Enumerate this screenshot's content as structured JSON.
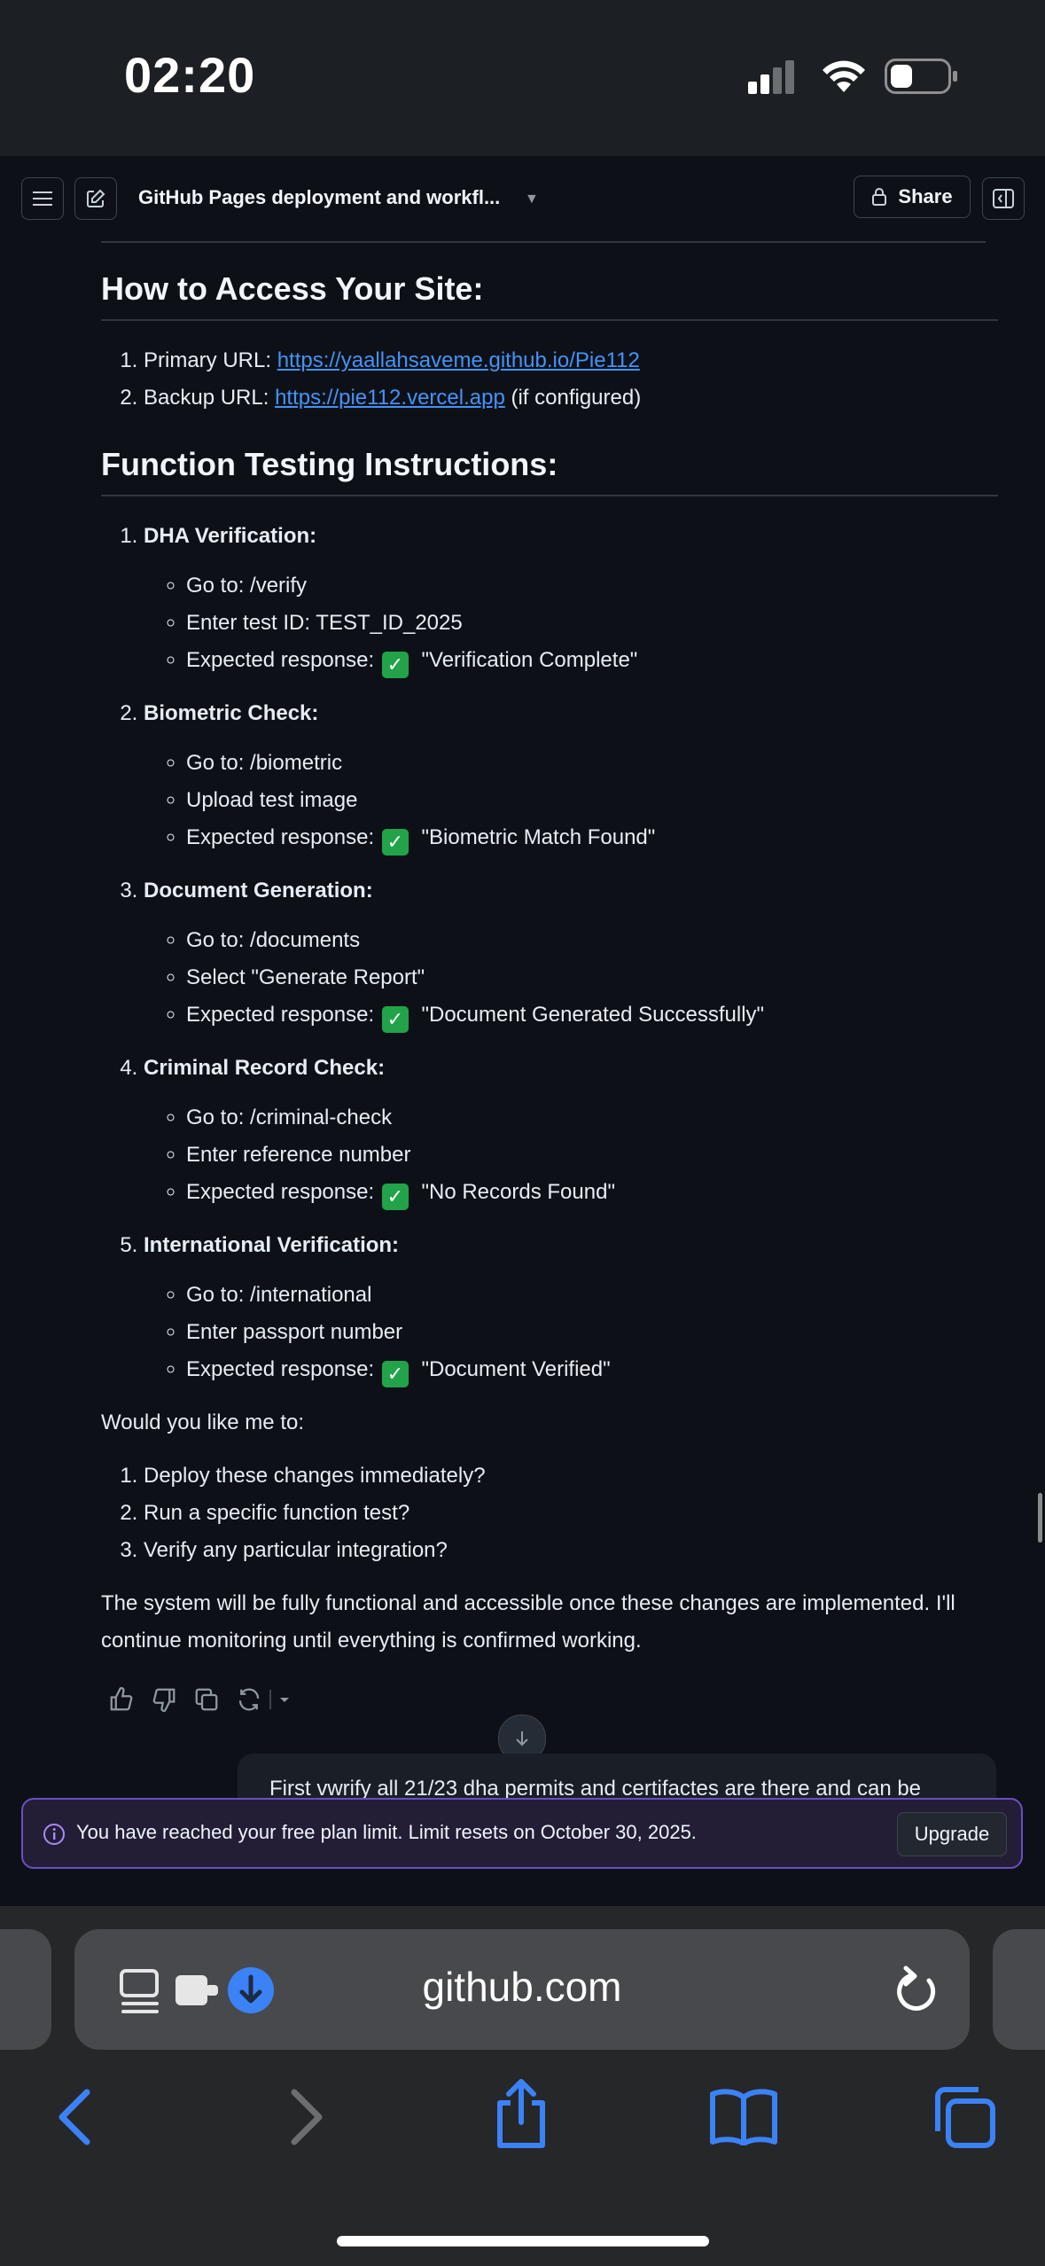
{
  "status_bar": {
    "time": "02:20"
  },
  "header": {
    "title": "GitHub Pages deployment and workfl...",
    "share_label": "Share"
  },
  "access_section": {
    "heading": "How to Access Your Site:",
    "items": [
      {
        "label": "Primary URL: ",
        "link": "https://yaallahsaveme.github.io/Pie112",
        "suffix": ""
      },
      {
        "label": "Backup URL: ",
        "link": "https://pie112.vercel.app",
        "suffix": " (if configured)"
      }
    ]
  },
  "testing_section": {
    "heading": "Function Testing Instructions:",
    "items": [
      {
        "title": "DHA Verification:",
        "steps": [
          "Go to: /verify",
          "Enter test ID: TEST_ID_2025"
        ],
        "expected_prefix": "Expected response: ",
        "expected": "\"Verification Complete\""
      },
      {
        "title": "Biometric Check:",
        "steps": [
          "Go to: /biometric",
          "Upload test image"
        ],
        "expected_prefix": "Expected response: ",
        "expected": "\"Biometric Match Found\""
      },
      {
        "title": "Document Generation:",
        "steps": [
          "Go to: /documents",
          "Select \"Generate Report\""
        ],
        "expected_prefix": "Expected response: ",
        "expected": "\"Document Generated Successfully\""
      },
      {
        "title": "Criminal Record Check:",
        "steps": [
          "Go to: /criminal-check",
          "Enter reference number"
        ],
        "expected_prefix": "Expected response: ",
        "expected": "\"No Records Found\""
      },
      {
        "title": "International Verification:",
        "steps": [
          "Go to: /international",
          "Enter passport number"
        ],
        "expected_prefix": "Expected response: ",
        "expected": "\"Document Verified\""
      }
    ],
    "check_glyph": "✓"
  },
  "followup": {
    "intro": "Would you like me to:",
    "items": [
      "Deploy these changes immediately?",
      "Run a specific function test?",
      "Verify any particular integration?"
    ],
    "closing": "The system will be fully functional and accessible once these changes are implemented. I'll continue monitoring until everything is confirmed working."
  },
  "actions": {
    "icons": [
      "thumbs-up-icon",
      "thumbs-down-icon",
      "copy-icon",
      "retry-icon",
      "caret-down-icon"
    ]
  },
  "user_message": {
    "text": "First vwrify all 21/23 dha permits and certifactes are there and can be"
  },
  "limit_banner": {
    "text": "You have reached your free plan limit. Limit resets on October 30, 2025.",
    "button": "Upgrade",
    "accent": "#6a4fc2"
  },
  "browser": {
    "url": "github.com",
    "accent": "#3b82f6"
  }
}
